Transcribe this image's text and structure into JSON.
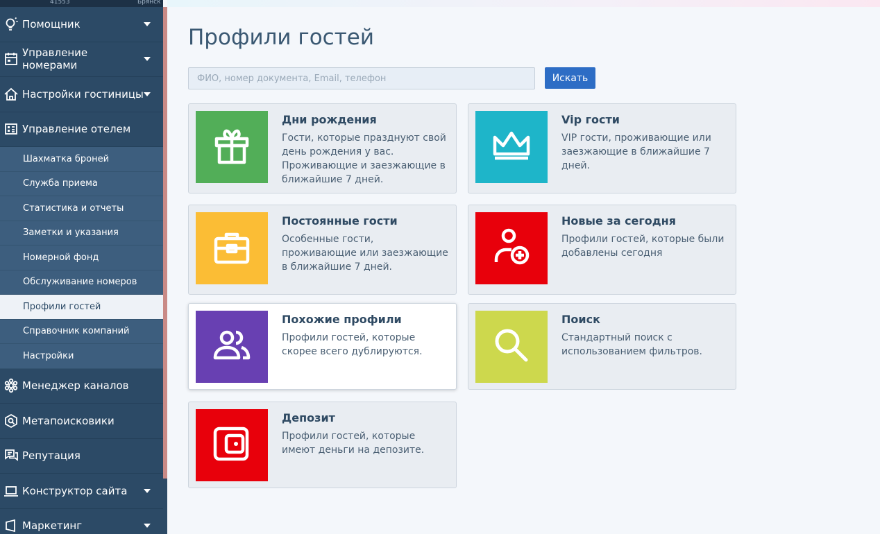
{
  "top_bar": {
    "left_text": "41553",
    "right_text": "Брянск"
  },
  "sidebar": {
    "items": [
      {
        "label": "Помощник",
        "icon": "lightbulb-icon",
        "chevron": true
      },
      {
        "label": "Управление номерами",
        "icon": "calendar-icon",
        "chevron": true
      },
      {
        "label": "Настройки гостиницы",
        "icon": "home-icon",
        "chevron": true
      },
      {
        "label": "Управление отелем",
        "icon": "dashboard-icon",
        "chevron": false
      },
      {
        "label": "Менеджер каналов",
        "icon": "network-icon",
        "chevron": false
      },
      {
        "label": "Метапоисковики",
        "icon": "meta-search-icon",
        "chevron": false
      },
      {
        "label": "Репутация",
        "icon": "chat-icon",
        "chevron": false
      },
      {
        "label": "Конструктор сайта",
        "icon": "laptop-icon",
        "chevron": true
      },
      {
        "label": "Маркетинг",
        "icon": "marketing-icon",
        "chevron": true
      }
    ],
    "submenu": [
      {
        "label": "Шахматка броней"
      },
      {
        "label": "Служба приема"
      },
      {
        "label": "Статистика и отчеты"
      },
      {
        "label": "Заметки и указания"
      },
      {
        "label": "Номерной фонд"
      },
      {
        "label": "Обслуживание номеров"
      },
      {
        "label": "Профили гостей",
        "active": true
      },
      {
        "label": "Справочник компаний"
      },
      {
        "label": "Настройки"
      }
    ]
  },
  "main": {
    "title": "Профили гостей",
    "search": {
      "placeholder": "ФИО, номер документа, Email, телефон",
      "value": "",
      "button_label": "Искать"
    },
    "cards": [
      {
        "title": "Дни рождения",
        "desc": "Гости, которые празднуют свой день рождения у вас. Проживающие и заезжающие в ближайшие 7 дней.",
        "color": "#52ae58",
        "icon": "gift-icon"
      },
      {
        "title": "Vip гости",
        "desc": "VIP гости, проживающие или заезжающие в ближайшие 7 дней.",
        "color": "#1eb5c9",
        "icon": "crown-icon"
      },
      {
        "title": "Постоянные гости",
        "desc": "Особенные гости, проживающие или заезжающие в ближайшие 7 дней.",
        "color": "#fbbd35",
        "icon": "briefcase-icon"
      },
      {
        "title": "Новые за сегодня",
        "desc": "Профили гостей, которые были добавлены сегодня",
        "color": "#e8000b",
        "icon": "user-add-icon"
      },
      {
        "title": "Похожие профили",
        "desc": "Профили гостей, которые скорее всего дублируются.",
        "color": "#6840b2",
        "icon": "users-icon"
      },
      {
        "title": "Поиск",
        "desc": "Стандартный поиск с использованием фильтров.",
        "color": "#cdd84d",
        "icon": "search-icon"
      },
      {
        "title": "Депозит",
        "desc": "Профили гостей, которые имеют деньги на депозите.",
        "color": "#e8000b",
        "icon": "wallet-icon"
      }
    ]
  }
}
